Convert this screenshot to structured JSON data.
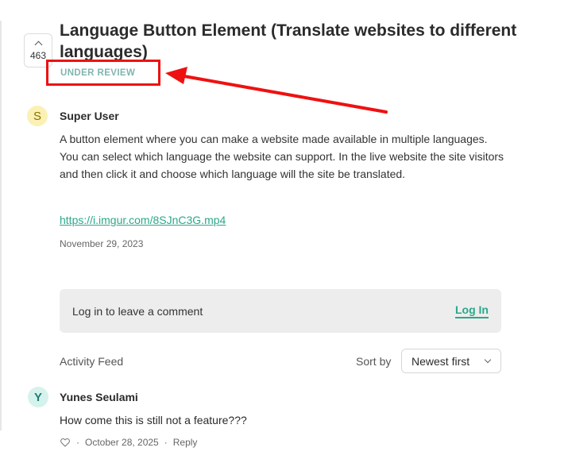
{
  "post": {
    "vote_count": "463",
    "title": "Language Button Element (Translate websites to different languages)",
    "status": "UNDER REVIEW",
    "author_initial": "S",
    "author": "Super User",
    "body": "A button element where you can make a website made available in multiple languages. You can select which language the website can support. In the live website the site visitors and then click it and choose which language will the site be translated.",
    "link": "https://i.imgur.com/8SJnC3G.mp4",
    "date": "November 29, 2023"
  },
  "comment_box": {
    "prompt": "Log in to leave a comment",
    "login_label": "Log In"
  },
  "activity": {
    "title": "Activity Feed",
    "sort_label": "Sort by",
    "sort_value": "Newest first"
  },
  "comments": [
    {
      "author_initial": "Y",
      "author": "Yunes Seulami",
      "text": "How come this is still not a feature???",
      "separator": "·",
      "date": "October 28, 2025",
      "reply_label": "Reply"
    }
  ],
  "colors": {
    "accent": "#2ba88a",
    "status": "#7fb5b0",
    "annotation": "#ee1111"
  }
}
